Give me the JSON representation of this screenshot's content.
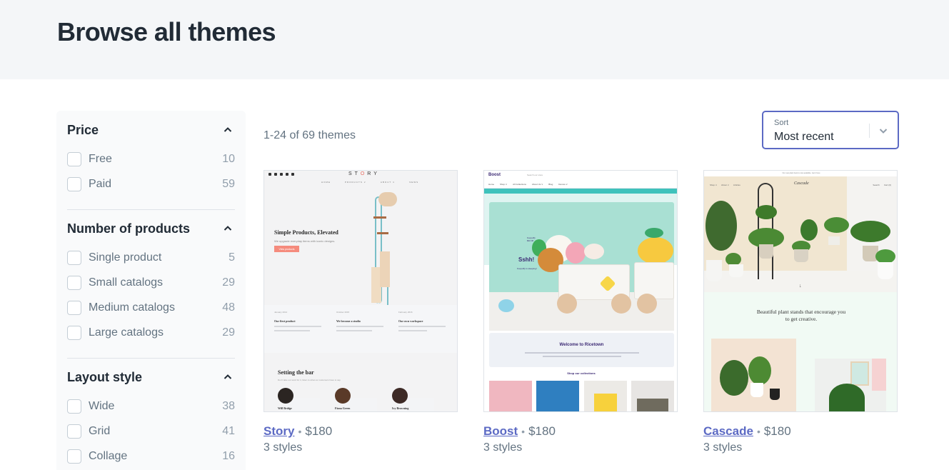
{
  "header": {
    "title": "Browse all themes"
  },
  "filters": [
    {
      "title": "Price",
      "expanded": true,
      "options": [
        {
          "label": "Free",
          "count": "10",
          "checked": false
        },
        {
          "label": "Paid",
          "count": "59",
          "checked": false
        }
      ]
    },
    {
      "title": "Number of products",
      "expanded": true,
      "options": [
        {
          "label": "Single product",
          "count": "5",
          "checked": false
        },
        {
          "label": "Small catalogs",
          "count": "29",
          "checked": false
        },
        {
          "label": "Medium catalogs",
          "count": "48",
          "checked": false
        },
        {
          "label": "Large catalogs",
          "count": "29",
          "checked": false
        }
      ]
    },
    {
      "title": "Layout style",
      "expanded": true,
      "options": [
        {
          "label": "Wide",
          "count": "38",
          "checked": false
        },
        {
          "label": "Grid",
          "count": "41",
          "checked": false
        },
        {
          "label": "Collage",
          "count": "16",
          "checked": false
        }
      ]
    }
  ],
  "results": {
    "count_text": "1-24 of 69 themes"
  },
  "sort": {
    "label": "Sort",
    "value": "Most recent"
  },
  "colors": {
    "accent": "#5c6ac4",
    "heading": "#212b36",
    "muted": "#637381",
    "hero_bg": "#f4f6f8"
  },
  "themes": [
    {
      "name": "Story",
      "price": "$180",
      "styles": "3 styles",
      "preview": {
        "logo": "STORY",
        "nav": [
          "HOME",
          "PRODUCTS ∨",
          "ABOUT ∨",
          "NEWS"
        ],
        "headline": "Simple Products, Elevated",
        "subhead": "We upgrade everyday items with iconic designs.",
        "cta": "View products",
        "timeline": [
          {
            "date": "January 2014",
            "title": "Our first product"
          },
          {
            "date": "October 2015",
            "title": "We become a studio"
          },
          {
            "date": "February 2016",
            "title": "Our own workspace"
          }
        ],
        "section_title": "Setting the bar",
        "section_sub": "Don't take our word for it, listen to what our customers have to say.",
        "people": [
          "Will Bridge",
          "Fiona Green",
          "Ivy Browning"
        ]
      }
    },
    {
      "name": "Boost",
      "price": "$180",
      "styles": "3 styles",
      "preview": {
        "logo": "Boost",
        "search_placeholder": "Search our store",
        "menu": [
          "Home",
          "Shop ∨",
          "All Collections",
          "About Us ∨",
          "Blog",
          "Demos ∨"
        ],
        "product_name": "Koopuffy",
        "product_price": "$32.00",
        "hero_title": "Sshh!",
        "hero_sub": "Koopuffy is sleeping!",
        "welcome": "Welcome to Ricetown",
        "collections": "Shop our collections"
      }
    },
    {
      "name": "Cascade",
      "price": "$180",
      "styles": "3 styles",
      "preview": {
        "announcement": "Our new plant book is now available. Get it here",
        "logo": "Cascade",
        "nav_left": [
          "Shop ∨",
          "About ∨",
          "Articles"
        ],
        "nav_right": [
          "Search",
          "Cart (0)"
        ],
        "headline": "Beautiful plant stands that encourage you to get creative."
      }
    }
  ]
}
